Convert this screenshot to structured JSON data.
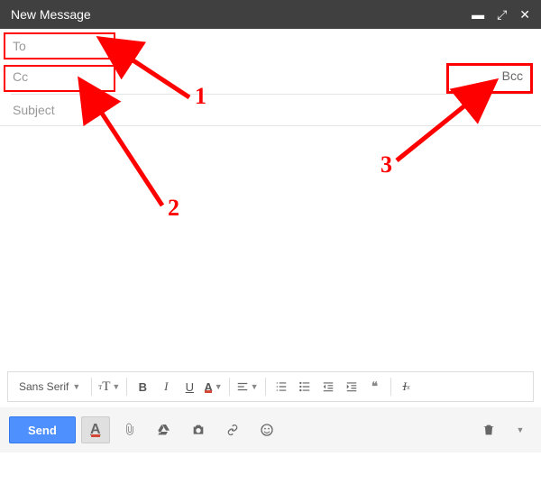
{
  "header": {
    "title": "New Message",
    "icons": {
      "minimize": "minimize",
      "expand": "expand",
      "close": "close"
    }
  },
  "fields": {
    "to_placeholder": "To",
    "cc_placeholder": "Cc",
    "bcc_label": "Bcc",
    "subject_placeholder": "Subject"
  },
  "format_bar": {
    "font_family": "Sans Serif",
    "buttons": {
      "size": "Text size",
      "bold": "B",
      "italic": "I",
      "underline": "U",
      "color": "A",
      "align": "Align",
      "ol": "Numbered list",
      "ul": "Bulleted list",
      "outdent": "Outdent",
      "indent": "Indent",
      "quote": "❝❝",
      "clear": "Remove formatting"
    }
  },
  "send_bar": {
    "send_label": "Send",
    "format_toggle": "A",
    "attach": "Attach files",
    "drive": "Insert from Drive",
    "photo": "Insert photo",
    "link": "Insert link",
    "emoji": "Insert emoji",
    "trash": "Discard draft",
    "more": "More options"
  },
  "annotations": {
    "n1": "1",
    "n2": "2",
    "n3": "3"
  },
  "colors": {
    "highlight": "#ff0000",
    "send_button": "#4d90fe",
    "titlebar": "#404040"
  }
}
